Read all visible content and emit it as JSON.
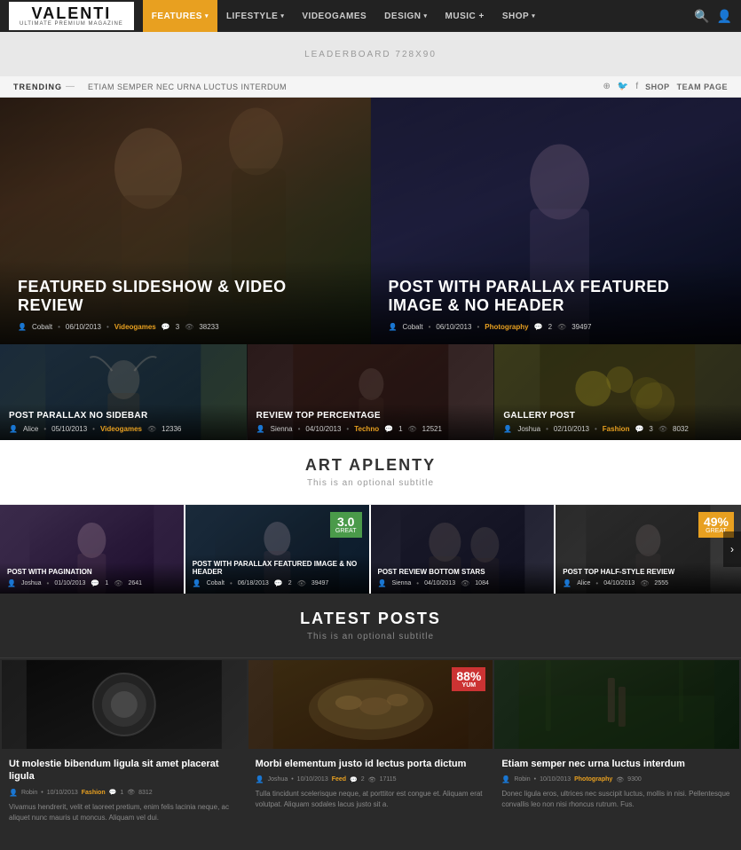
{
  "nav": {
    "logo": "VALENTI",
    "logo_sub": "ULTIMATE PREMIUM MAGAZINE",
    "items": [
      {
        "label": "FEATURES",
        "active": true,
        "arrow": true
      },
      {
        "label": "LIFESTYLE",
        "active": false,
        "arrow": true
      },
      {
        "label": "VIDEOGAMES",
        "active": false,
        "arrow": false
      },
      {
        "label": "DESIGN",
        "active": false,
        "arrow": true
      },
      {
        "label": "MUSIC +",
        "active": false,
        "arrow": false
      },
      {
        "label": "SHOP",
        "active": false,
        "arrow": true
      }
    ]
  },
  "leaderboard": {
    "text": "LEADERBOARD 728X90"
  },
  "trending": {
    "label": "TRENDING",
    "text": "ETIAM SEMPER NEC URNA LUCTUS INTERDUM",
    "links": [
      "SHOP",
      "TEAM PAGE"
    ]
  },
  "hero": [
    {
      "title": "FEATURED SLIDESHOW & VIDEO REVIEW",
      "author": "Cobalt",
      "date": "06/10/2013",
      "category": "Videogames",
      "comments": "3",
      "views": "38233"
    },
    {
      "title": "POST WITH PARALLAX FEATURED IMAGE & NO HEADER",
      "author": "Cobalt",
      "date": "06/10/2013",
      "category": "Photography",
      "comments": "2",
      "views": "39497"
    }
  ],
  "secondary": [
    {
      "title": "POST PARALLAX NO SIDEBAR",
      "author": "Alice",
      "date": "05/10/2013",
      "category": "Videogames",
      "views": "12336"
    },
    {
      "title": "REVIEW TOP PERCENTAGE",
      "author": "Sienna",
      "date": "04/10/2013",
      "category": "Techno",
      "comments": "1",
      "views": "12521"
    },
    {
      "title": "GALLERY POST",
      "author": "Joshua",
      "date": "02/10/2013",
      "category": "Fashion",
      "comments": "3",
      "views": "8032"
    }
  ],
  "art_aplenty": {
    "title": "ART APLENTY",
    "subtitle": "This is an optional subtitle"
  },
  "carousel": {
    "items": [
      {
        "title": "POST WITH PAGINATION",
        "author": "Joshua",
        "date": "01/10/2013",
        "comments": "1",
        "views": "2641"
      },
      {
        "title": "POST WITH PARALLAX FEATURED IMAGE & NO HEADER",
        "author": "Cobalt",
        "date": "06/18/2013",
        "comments": "2",
        "views": "39497"
      },
      {
        "title": "POST REVIEW BOTTOM STARS",
        "author": "Sienna",
        "date": "04/10/2013",
        "views": "1084"
      },
      {
        "title": "POST TOP HALF-STYLE REVIEW",
        "author": "Alice",
        "date": "04/10/2013",
        "views": "2555"
      }
    ],
    "score": "3.0",
    "score_label": "GREAT",
    "pct": "49%",
    "pct_label": "GREAT"
  },
  "latest_posts": {
    "title": "LATEST POSTS",
    "subtitle": "This is an optional subtitle",
    "posts": [
      {
        "title": "Ut molestie bibendum ligula sit amet placerat ligula",
        "author": "Robin",
        "date": "10/10/2013",
        "category": "Fashion",
        "comments": "1",
        "views": "8312",
        "text": "Vivamus hendrerit, velit et laoreet pretium, enim felis lacinia neque, ac aliquet nunc mauris ut moncus. Aliquam vel dui."
      },
      {
        "title": "Morbi elementum justo id lectus porta dictum",
        "author": "Joshua",
        "date": "10/10/2013",
        "category": "Feed",
        "comments": "2",
        "views": "17115",
        "pct": "88%",
        "pct_label": "YUM",
        "text": "Tulla tincidunt scelerisque neque, at porttitor est congue et. Aliquam erat volutpat. Aliquam sodales lacus justo sit a."
      },
      {
        "title": "Etiam semper nec urna luctus interdum",
        "author": "Robin",
        "date": "10/10/2013",
        "category": "Photography",
        "views": "9300",
        "text": "Donec ligula eros, ultrices nec suscipit luctus, mollis in nisi. Pellentesque convallis leo non nisi rhoncus rutrum. Fus."
      }
    ]
  }
}
